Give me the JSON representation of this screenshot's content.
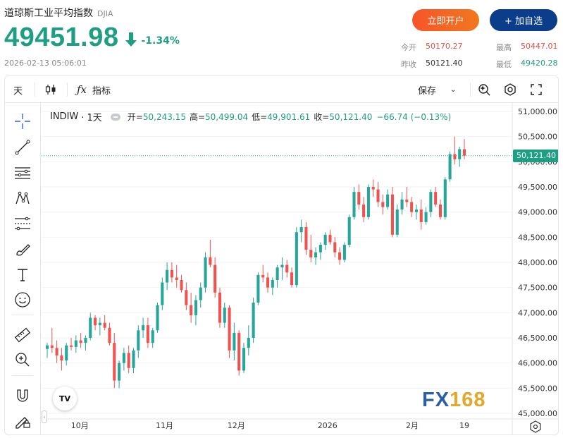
{
  "header": {
    "title": "道琼斯工业平均指数",
    "code": "DJIA",
    "price": "49451.98",
    "change_pct": "-1.34%",
    "timestamp": "2026-02-13 05:06:01",
    "open_account_label": "立即开户",
    "add_watch_label": "+ 加自选",
    "stats": {
      "open_label": "今开",
      "open_value": "50170.27",
      "prev_close_label": "昨收",
      "prev_close_value": "50121.40",
      "high_label": "最高",
      "high_value": "50447.01",
      "low_label": "最低",
      "low_value": "49420.28"
    }
  },
  "toolbar": {
    "interval": "天",
    "indicators_label": "指标",
    "save_label": "保存"
  },
  "chart_legend": {
    "symbol": "INDIW",
    "interval": "· 1天",
    "open_label": "开=",
    "open": "50,243.15",
    "high_label": "高=",
    "high": "50,499.04",
    "low_label": "低=",
    "low": "49,901.61",
    "close_label": "收=",
    "close": "50,121.40",
    "change": "−66.74 (−0.13%)"
  },
  "watermark": {
    "fx": "FX",
    "num": "168"
  },
  "colors": {
    "up": "#26a69a",
    "down": "#ef5350",
    "accent_green": "#1e9e82",
    "button_orange": "#f7542b",
    "button_blue": "#0b3d8a"
  },
  "chart_data": {
    "type": "candlestick",
    "y_axis": {
      "ticks": [
        "51,000.00",
        "50,500.00",
        "50,000.00",
        "49,500.00",
        "49,000.00",
        "48,500.00",
        "48,000.00",
        "47,500.00",
        "47,000.00",
        "46,500.00",
        "46,000.00",
        "45,500.00",
        "45,000.00"
      ],
      "range": [
        45000,
        51000
      ]
    },
    "x_axis": {
      "ticks": [
        "10月",
        "11月",
        "12月",
        "2026",
        "2月",
        "19"
      ]
    },
    "last_price_label": "50,121.40",
    "candles": [
      [
        46280,
        46400,
        46100,
        46350
      ],
      [
        46350,
        46700,
        46200,
        46300
      ],
      [
        46300,
        46450,
        46000,
        46150
      ],
      [
        46150,
        46300,
        45850,
        46050
      ],
      [
        46050,
        46400,
        45950,
        46350
      ],
      [
        46350,
        46500,
        46250,
        46320
      ],
      [
        46320,
        46550,
        46200,
        46450
      ],
      [
        46450,
        46600,
        46300,
        46400
      ],
      [
        46400,
        46550,
        46250,
        46500
      ],
      [
        46500,
        47000,
        46450,
        46900
      ],
      [
        46900,
        46950,
        46650,
        46750
      ],
      [
        46750,
        46900,
        46550,
        46800
      ],
      [
        46800,
        46950,
        46650,
        46700
      ],
      [
        46700,
        46800,
        46350,
        46400
      ],
      [
        46400,
        46600,
        45500,
        45650
      ],
      [
        45650,
        46050,
        45500,
        46000
      ],
      [
        46000,
        46300,
        45850,
        46200
      ],
      [
        46200,
        46350,
        45800,
        45900
      ],
      [
        45900,
        46300,
        45800,
        46250
      ],
      [
        46250,
        46750,
        46100,
        46650
      ],
      [
        46650,
        46900,
        46500,
        46750
      ],
      [
        46750,
        46900,
        46300,
        46400
      ],
      [
        46400,
        46700,
        46300,
        46650
      ],
      [
        46650,
        47200,
        46600,
        47150
      ],
      [
        47150,
        47700,
        47050,
        47600
      ],
      [
        47600,
        48000,
        47450,
        47850
      ],
      [
        47850,
        48000,
        47600,
        47700
      ],
      [
        47700,
        47950,
        47500,
        47650
      ],
      [
        47650,
        47750,
        47400,
        47450
      ],
      [
        47450,
        47600,
        47050,
        47150
      ],
      [
        47150,
        47400,
        46800,
        46950
      ],
      [
        46950,
        47350,
        46750,
        47250
      ],
      [
        47250,
        47600,
        47100,
        47500
      ],
      [
        47500,
        48200,
        47400,
        48100
      ],
      [
        48100,
        48450,
        47900,
        47950
      ],
      [
        47950,
        48100,
        47300,
        47400
      ],
      [
        47400,
        47500,
        46700,
        46800
      ],
      [
        46800,
        47200,
        46700,
        47100
      ],
      [
        47100,
        47150,
        46100,
        46250
      ],
      [
        46250,
        46800,
        46050,
        46600
      ],
      [
        46600,
        46650,
        45750,
        45850
      ],
      [
        45850,
        46400,
        45800,
        46300
      ],
      [
        46300,
        46750,
        46150,
        46500
      ],
      [
        46500,
        47300,
        46400,
        47200
      ],
      [
        47200,
        47800,
        47150,
        47750
      ],
      [
        47750,
        47950,
        47600,
        47700
      ],
      [
        47700,
        47800,
        47400,
        47500
      ],
      [
        47500,
        47700,
        47350,
        47650
      ],
      [
        47650,
        47950,
        47500,
        47900
      ],
      [
        47900,
        48100,
        47650,
        47950
      ],
      [
        47950,
        48050,
        47700,
        47800
      ],
      [
        47800,
        47900,
        47500,
        47550
      ],
      [
        47550,
        48700,
        47500,
        48600
      ],
      [
        48600,
        48850,
        48400,
        48700
      ],
      [
        48700,
        48800,
        48150,
        48250
      ],
      [
        48250,
        48550,
        48000,
        48100
      ],
      [
        48100,
        48300,
        47950,
        48200
      ],
      [
        48200,
        48400,
        48050,
        48350
      ],
      [
        48350,
        48600,
        48250,
        48550
      ],
      [
        48550,
        48650,
        48350,
        48400
      ],
      [
        48400,
        48500,
        48100,
        48200
      ],
      [
        48200,
        48300,
        47950,
        48050
      ],
      [
        48050,
        48400,
        48000,
        48350
      ],
      [
        48350,
        48950,
        48300,
        48900
      ],
      [
        48900,
        49500,
        48850,
        49400
      ],
      [
        49400,
        49550,
        49050,
        49150
      ],
      [
        49150,
        49300,
        48800,
        48900
      ],
      [
        48900,
        49550,
        48850,
        49500
      ],
      [
        49500,
        49650,
        49300,
        49450
      ],
      [
        49450,
        49600,
        49100,
        49200
      ],
      [
        49200,
        49350,
        48950,
        49100
      ],
      [
        49100,
        49450,
        49050,
        49350
      ],
      [
        49350,
        49500,
        48500,
        48550
      ],
      [
        48550,
        49150,
        48500,
        49050
      ],
      [
        49050,
        49400,
        48950,
        49250
      ],
      [
        49250,
        49500,
        49100,
        49200
      ],
      [
        49200,
        49300,
        48900,
        49000
      ],
      [
        49000,
        49150,
        48850,
        49050
      ],
      [
        49050,
        49250,
        48650,
        48800
      ],
      [
        48800,
        49100,
        48750,
        49000
      ],
      [
        49000,
        49450,
        48900,
        49400
      ],
      [
        49400,
        49500,
        49100,
        49150
      ],
      [
        49150,
        49250,
        48850,
        48900
      ],
      [
        48900,
        49700,
        48850,
        49650
      ],
      [
        49650,
        50200,
        49600,
        50150
      ],
      [
        50150,
        50500,
        49950,
        50050
      ],
      [
        50050,
        50300,
        49900,
        50250
      ],
      [
        50250,
        50450,
        50050,
        50121
      ]
    ]
  }
}
